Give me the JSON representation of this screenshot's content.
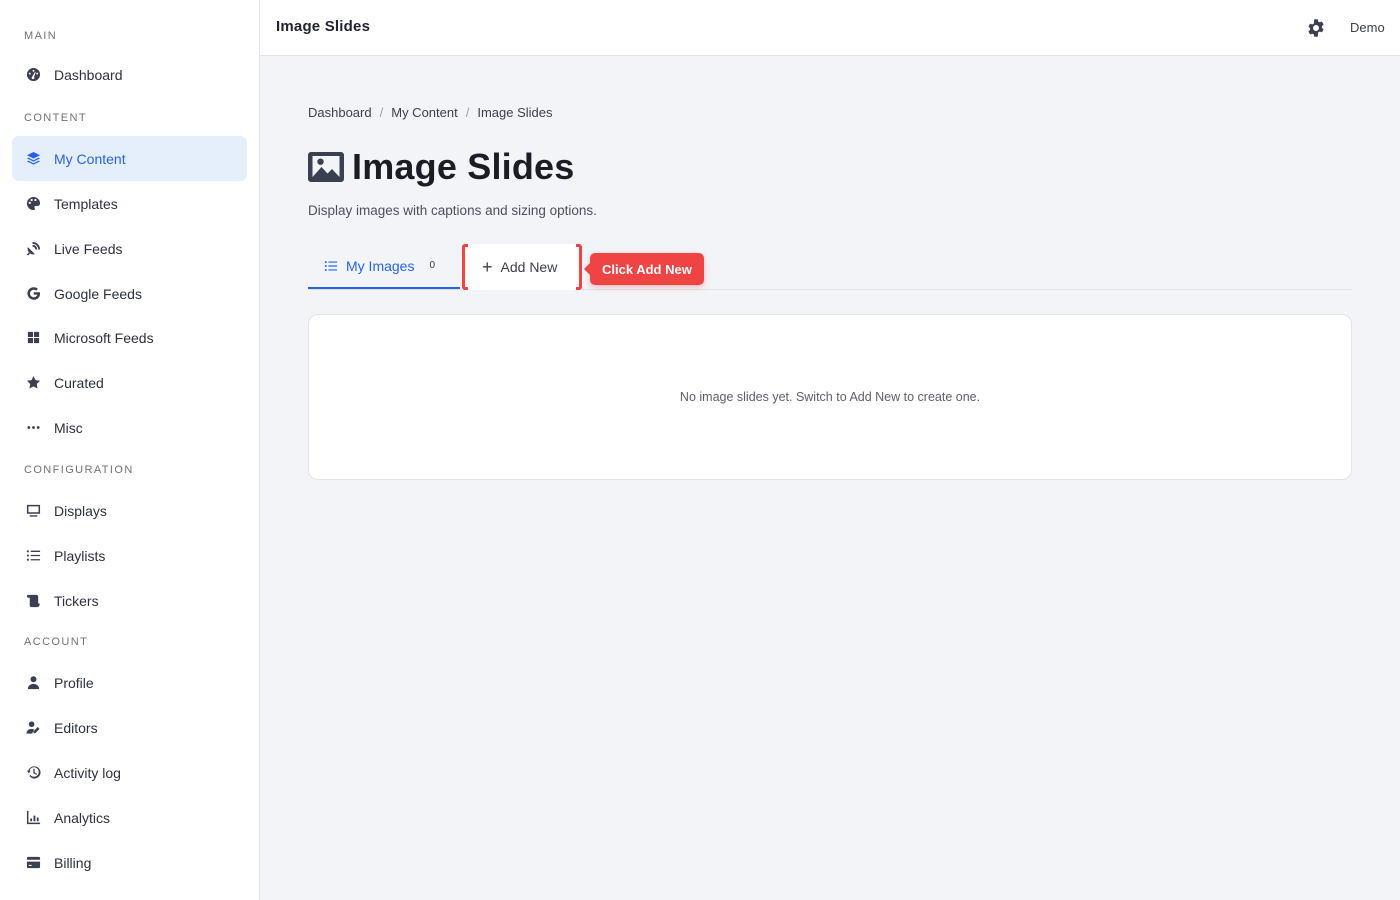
{
  "app": {
    "title": "Image Slides",
    "user": "Demo"
  },
  "sidebar": {
    "sections": [
      {
        "label": "MAIN",
        "items": [
          {
            "label": "Dashboard",
            "icon": "dashboard-icon"
          }
        ]
      },
      {
        "label": "CONTENT",
        "items": [
          {
            "label": "My Content",
            "icon": "layers-icon",
            "active": true
          },
          {
            "label": "Templates",
            "icon": "palette-icon"
          },
          {
            "label": "Live Feeds",
            "icon": "satellite-dish-icon"
          },
          {
            "label": "Google Feeds",
            "icon": "google-icon"
          },
          {
            "label": "Microsoft Feeds",
            "icon": "windows-icon"
          },
          {
            "label": "Curated",
            "icon": "star-icon"
          },
          {
            "label": "Misc",
            "icon": "ellipsis-icon"
          }
        ]
      },
      {
        "label": "CONFIGURATION",
        "items": [
          {
            "label": "Displays",
            "icon": "monitor-icon"
          },
          {
            "label": "Playlists",
            "icon": "list-icon"
          },
          {
            "label": "Tickers",
            "icon": "scroll-icon"
          }
        ]
      },
      {
        "label": "ACCOUNT",
        "items": [
          {
            "label": "Profile",
            "icon": "user-icon"
          },
          {
            "label": "Editors",
            "icon": "user-pen-icon"
          },
          {
            "label": "Activity log",
            "icon": "history-icon"
          },
          {
            "label": "Analytics",
            "icon": "chart-icon"
          },
          {
            "label": "Billing",
            "icon": "credit-card-icon"
          }
        ]
      }
    ]
  },
  "breadcrumb": [
    "Dashboard",
    "My Content",
    "Image Slides"
  ],
  "page": {
    "title": "Image Slides",
    "subtitle": "Display images with captions and sizing options."
  },
  "tabs": {
    "my_images": {
      "label": "My Images",
      "count": "0"
    },
    "add_new": {
      "label": "Add New"
    }
  },
  "tooltip": "Click Add New",
  "empty_state": "No image slides yet. Switch to Add New to create one.",
  "colors": {
    "accent": "#2563eb",
    "highlight": "#ef4444",
    "active_bg": "#e5eefb"
  }
}
